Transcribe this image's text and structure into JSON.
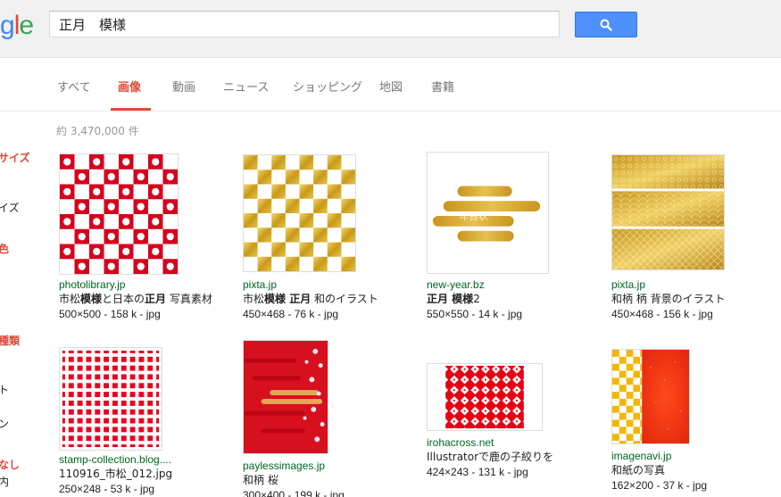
{
  "search": {
    "query": "正月　模様"
  },
  "logo": {
    "visible_letters": "gle"
  },
  "tabs": [
    {
      "label": "すべて"
    },
    {
      "label": "画像"
    },
    {
      "label": "動画"
    },
    {
      "label": "ニュース"
    },
    {
      "label": "ショッピング"
    },
    {
      "label": "地図"
    },
    {
      "label": "書籍"
    }
  ],
  "result_stats": "約 3,470,000 件",
  "sidebar": [
    {
      "text": "サイズ"
    },
    {
      "text": "イズ"
    },
    {
      "text": "色"
    },
    {
      "text": "種類"
    },
    {
      "text": "ト"
    },
    {
      "text": "ン"
    },
    {
      "text": "なし"
    },
    {
      "text": "内"
    }
  ],
  "results": [
    {
      "site": "photolibrary.jp",
      "title_parts": [
        {
          "t": "市松",
          "b": false
        },
        {
          "t": "模様",
          "b": true
        },
        {
          "t": "と日本の",
          "b": false
        },
        {
          "t": "正月",
          "b": true
        },
        {
          "t": " 写真素材",
          "b": false
        }
      ],
      "size": "500×500 - 158 k - jpg"
    },
    {
      "site": "pixta.jp",
      "title_parts": [
        {
          "t": "市松",
          "b": false
        },
        {
          "t": "模様 正月",
          "b": true
        },
        {
          "t": " 和のイラスト",
          "b": false
        }
      ],
      "size": "450×468 - 76 k - jpg"
    },
    {
      "site": "new-year.bz",
      "title_parts": [
        {
          "t": "正月 模様",
          "b": true
        },
        {
          "t": "2",
          "b": false
        }
      ],
      "size": "550×550 - 14 k - jpg",
      "image_text": "年賀状"
    },
    {
      "site": "pixta.jp",
      "title_parts": [
        {
          "t": "和柄 柄 背景のイラスト",
          "b": false
        }
      ],
      "size": "450×468 - 156 k - jpg"
    },
    {
      "site": "stamp-collection.blog....",
      "title_parts": [
        {
          "t": "110916_市松_012.jpg",
          "b": false
        }
      ],
      "size": "250×248 - 53 k - jpg"
    },
    {
      "site": "paylessimages.jp",
      "title_parts": [
        {
          "t": "和柄 桜",
          "b": false
        }
      ],
      "size": "300×400 - 199 k - jpg"
    },
    {
      "site": "irohacross.net",
      "title_parts": [
        {
          "t": "Illustratorで鹿の子絞りを",
          "b": false
        }
      ],
      "size": "424×243 - 131 k - jpg"
    },
    {
      "site": "imagenavi.jp",
      "title_parts": [
        {
          "t": "和紙の写真",
          "b": false
        }
      ],
      "size": "162×200 - 37 k - jpg"
    }
  ],
  "colors": {
    "accent_red": "#dd4b39",
    "link_green": "#006621",
    "search_blue": "#4d90fe",
    "pattern_red": "#e0001b",
    "gold": "#d4a21a"
  },
  "icons": {
    "search": "search-icon"
  }
}
